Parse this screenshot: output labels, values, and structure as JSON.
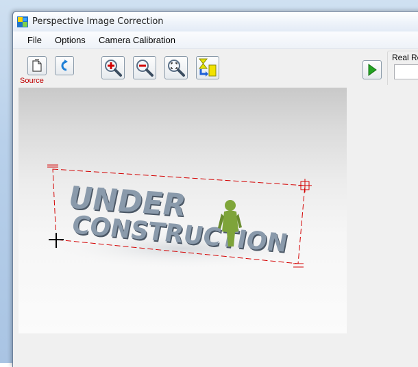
{
  "window": {
    "title": "Perspective Image Correction"
  },
  "menu": {
    "items": [
      "File",
      "Options",
      "Camera Calibration"
    ]
  },
  "toolbar": {
    "open_icon": "open-file-icon",
    "rotate_icon": "rotate-icon",
    "zoom_in_icon": "zoom-in-icon",
    "zoom_out_icon": "zoom-out-icon",
    "zoom_fit_icon": "zoom-fit-icon",
    "transform_icon": "transform-icon",
    "run_icon": "play-icon",
    "source_label": "Source"
  },
  "right_panel": {
    "real_label": "Real Re"
  },
  "image": {
    "line1": "UNDER",
    "line2": "CONSTRUCTION",
    "selection_color": "#d40000",
    "text_color": "#7d8c9c"
  }
}
